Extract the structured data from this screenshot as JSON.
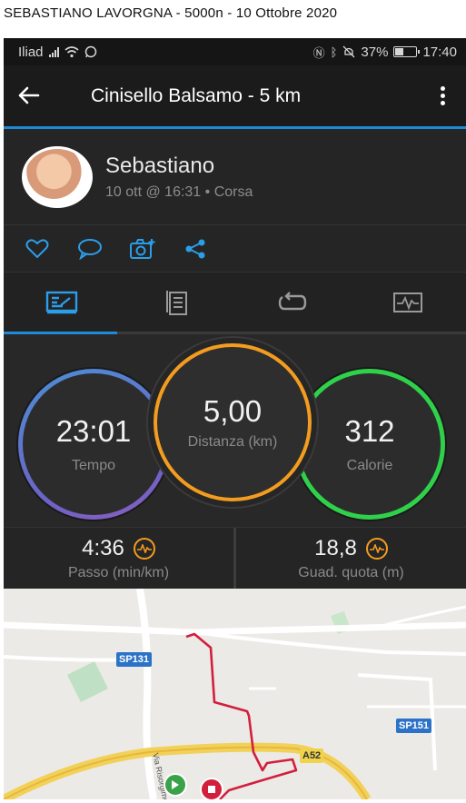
{
  "caption": "SEBASTIANO LAVORGNA  -  5000n  -  10 Ottobre 2020",
  "status_bar": {
    "carrier": "Iliad",
    "battery": "37%",
    "battery_level": 0.37,
    "time": "17:40"
  },
  "app_bar": {
    "title": "Cinisello Balsamo - 5 km",
    "back_icon": "arrow-left-icon",
    "more_icon": "more-vertical-icon"
  },
  "profile": {
    "name": "Sebastiano",
    "meta": "10 ott @ 16:31 • Corsa"
  },
  "actions": [
    {
      "icon": "heart-icon"
    },
    {
      "icon": "comment-icon"
    },
    {
      "icon": "add-photo-icon"
    },
    {
      "icon": "share-icon"
    }
  ],
  "tabs": [
    {
      "icon": "stats-icon",
      "active": true
    },
    {
      "icon": "details-list-icon",
      "active": false
    },
    {
      "icon": "laps-icon",
      "active": false
    },
    {
      "icon": "chart-icon",
      "active": false
    }
  ],
  "stats": {
    "time": {
      "value": "23:01",
      "label": "Tempo"
    },
    "distance": {
      "value": "5,00",
      "label": "Distanza (km)"
    },
    "calories": {
      "value": "312",
      "label": "Calorie"
    }
  },
  "metrics": {
    "pace": {
      "value": "4:36",
      "label": "Passo (min/km)"
    },
    "elevation": {
      "value": "18,8",
      "label": "Guad. quota (m)"
    }
  },
  "map": {
    "labels": {
      "sp131": "SP131",
      "sp151": "SP151",
      "a52": "A52",
      "street": "Via Risorgimento"
    }
  },
  "colors": {
    "accent": "#1f8bd6",
    "time_ring": "#4b8fd6",
    "distance_ring": "#f39c1f",
    "calories_ring": "#2fd14a",
    "route": "#d21f3c"
  }
}
